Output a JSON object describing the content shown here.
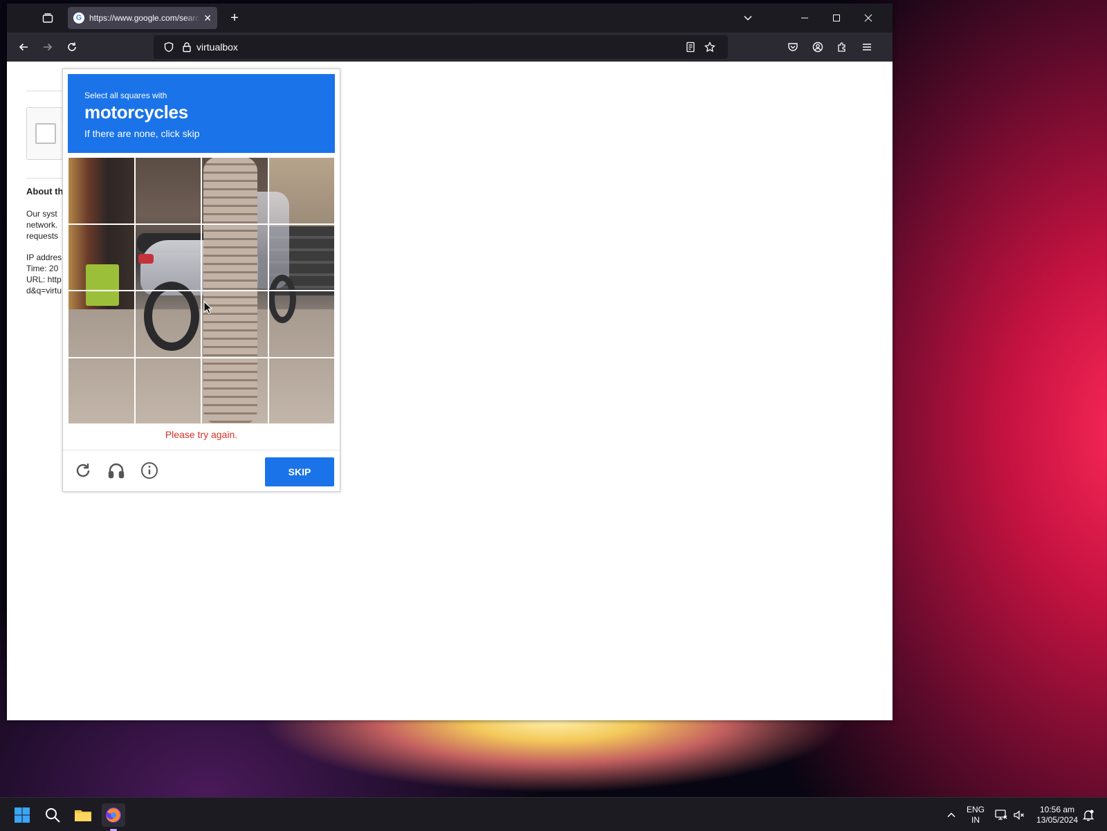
{
  "browser": {
    "tab_title": "https://www.google.com/search",
    "address": "virtualbox"
  },
  "page": {
    "heading_partial": "About th",
    "body_partial": [
      "Our syst",
      "network.",
      "requests"
    ],
    "info_partial": [
      "IP addres",
      "Time: 20",
      "URL: http",
      "d&q=virtu"
    ]
  },
  "captcha": {
    "instruction": "Select all squares with",
    "target": "motorcycles",
    "hint": "If there are none, click skip",
    "error": "Please try again.",
    "skip_label": "SKIP",
    "grid_rows": 4,
    "grid_cols": 4
  },
  "taskbar": {
    "lang_line1": "ENG",
    "lang_line2": "IN",
    "time": "10:56 am",
    "date": "13/05/2024"
  },
  "colors": {
    "captcha_blue": "#1a73e8",
    "error_red": "#d93025",
    "browser_dark": "#1c1b22"
  }
}
